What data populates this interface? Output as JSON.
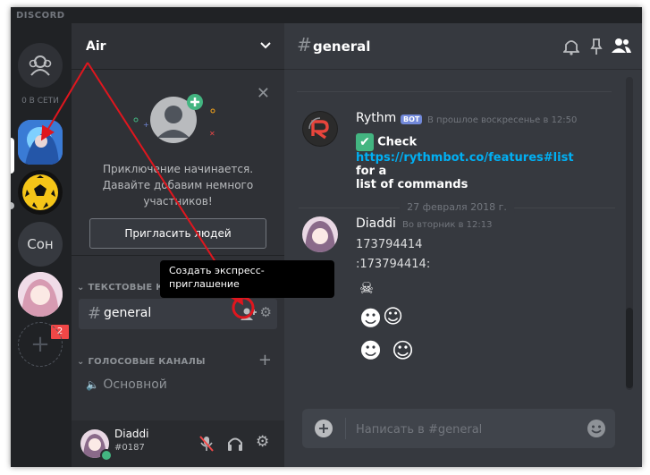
{
  "app": {
    "brand": "DISCORD"
  },
  "colors": {
    "accent": "#7289da",
    "danger": "#f04747",
    "link": "#00b0f4",
    "annotation": "#e0161e"
  },
  "servers": {
    "online_label": "0 В СЕТИ",
    "items": [
      {
        "label": "Сон"
      }
    ],
    "badge": "2"
  },
  "sidebar": {
    "guild_name": "Air",
    "invite": {
      "text_line1": "Приключение начинается.",
      "text_line2": "Давайте добавим немного",
      "text_line3": "участников!",
      "button": "Пригласить людей"
    },
    "categories": {
      "text": "ТЕКСТОВЫЕ КАНАЛЫ",
      "voice": "ГОЛОСОВЫЕ КАНАЛЫ"
    },
    "text_channel": "general",
    "voice_channel": "Основной",
    "tooltip": "Создать экспресс-приглашение",
    "user": {
      "name": "Diaddi",
      "tag": "#0187"
    }
  },
  "chat": {
    "channel": "general",
    "messages": [
      {
        "author": "Rythm",
        "bot_tag": "BOT",
        "time": "В прошлое воскресенье в 12:50",
        "check": "Check",
        "link": "https://rythmbot.co/features#list",
        "tail1": " for a",
        "tail2": "list of commands"
      },
      {
        "author": "Diaddi",
        "time": "Во вторник в 12:13",
        "line1": "173794414",
        "line2": ":173794414:"
      }
    ],
    "date_divider": "27 февраля 2018 г.",
    "input_placeholder": "Написать в #general"
  }
}
